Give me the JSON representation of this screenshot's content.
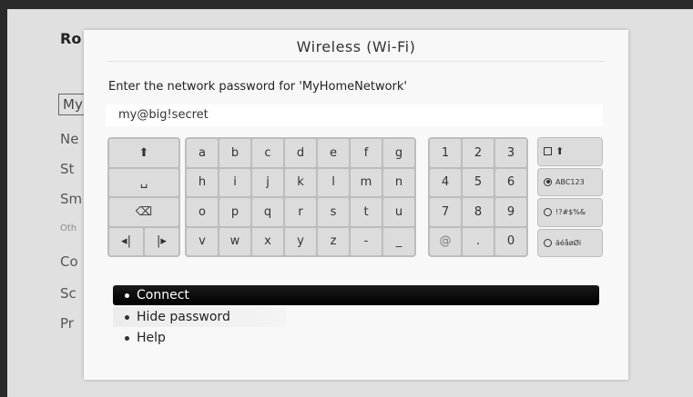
{
  "background": {
    "title": "Ro",
    "items": [
      "My",
      "Ne",
      "St",
      "Sm",
      "Oth",
      "Co",
      "Sc",
      "Pr"
    ]
  },
  "dialog": {
    "title": "Wireless (Wi-Fi)",
    "prompt": "Enter the network password for 'MyHomeNetwork'",
    "password_value": "my@big!secret"
  },
  "keyboard": {
    "controls": {
      "shift": "⬆",
      "space": "␣",
      "backspace": "⌫",
      "cursor_left": "◂|",
      "cursor_right": "|▸"
    },
    "letters": [
      "a",
      "b",
      "c",
      "d",
      "e",
      "f",
      "g",
      "h",
      "i",
      "j",
      "k",
      "l",
      "m",
      "n",
      "o",
      "p",
      "q",
      "r",
      "s",
      "t",
      "u",
      "v",
      "w",
      "x",
      "y",
      "z",
      "-",
      "_"
    ],
    "numbers": [
      "1",
      "2",
      "3",
      "4",
      "5",
      "6",
      "7",
      "8",
      "9",
      "@",
      ".",
      "0"
    ],
    "modes": {
      "caps": "⬆",
      "abc": "ABC123",
      "symbols": "!?#$%&",
      "accents": "äéåøØi"
    }
  },
  "menu": {
    "connect": "Connect",
    "hide_password": "Hide password",
    "help": "Help"
  },
  "colors": {
    "selected_bg": "#000000",
    "dialog_bg": "#f8f8f8"
  }
}
